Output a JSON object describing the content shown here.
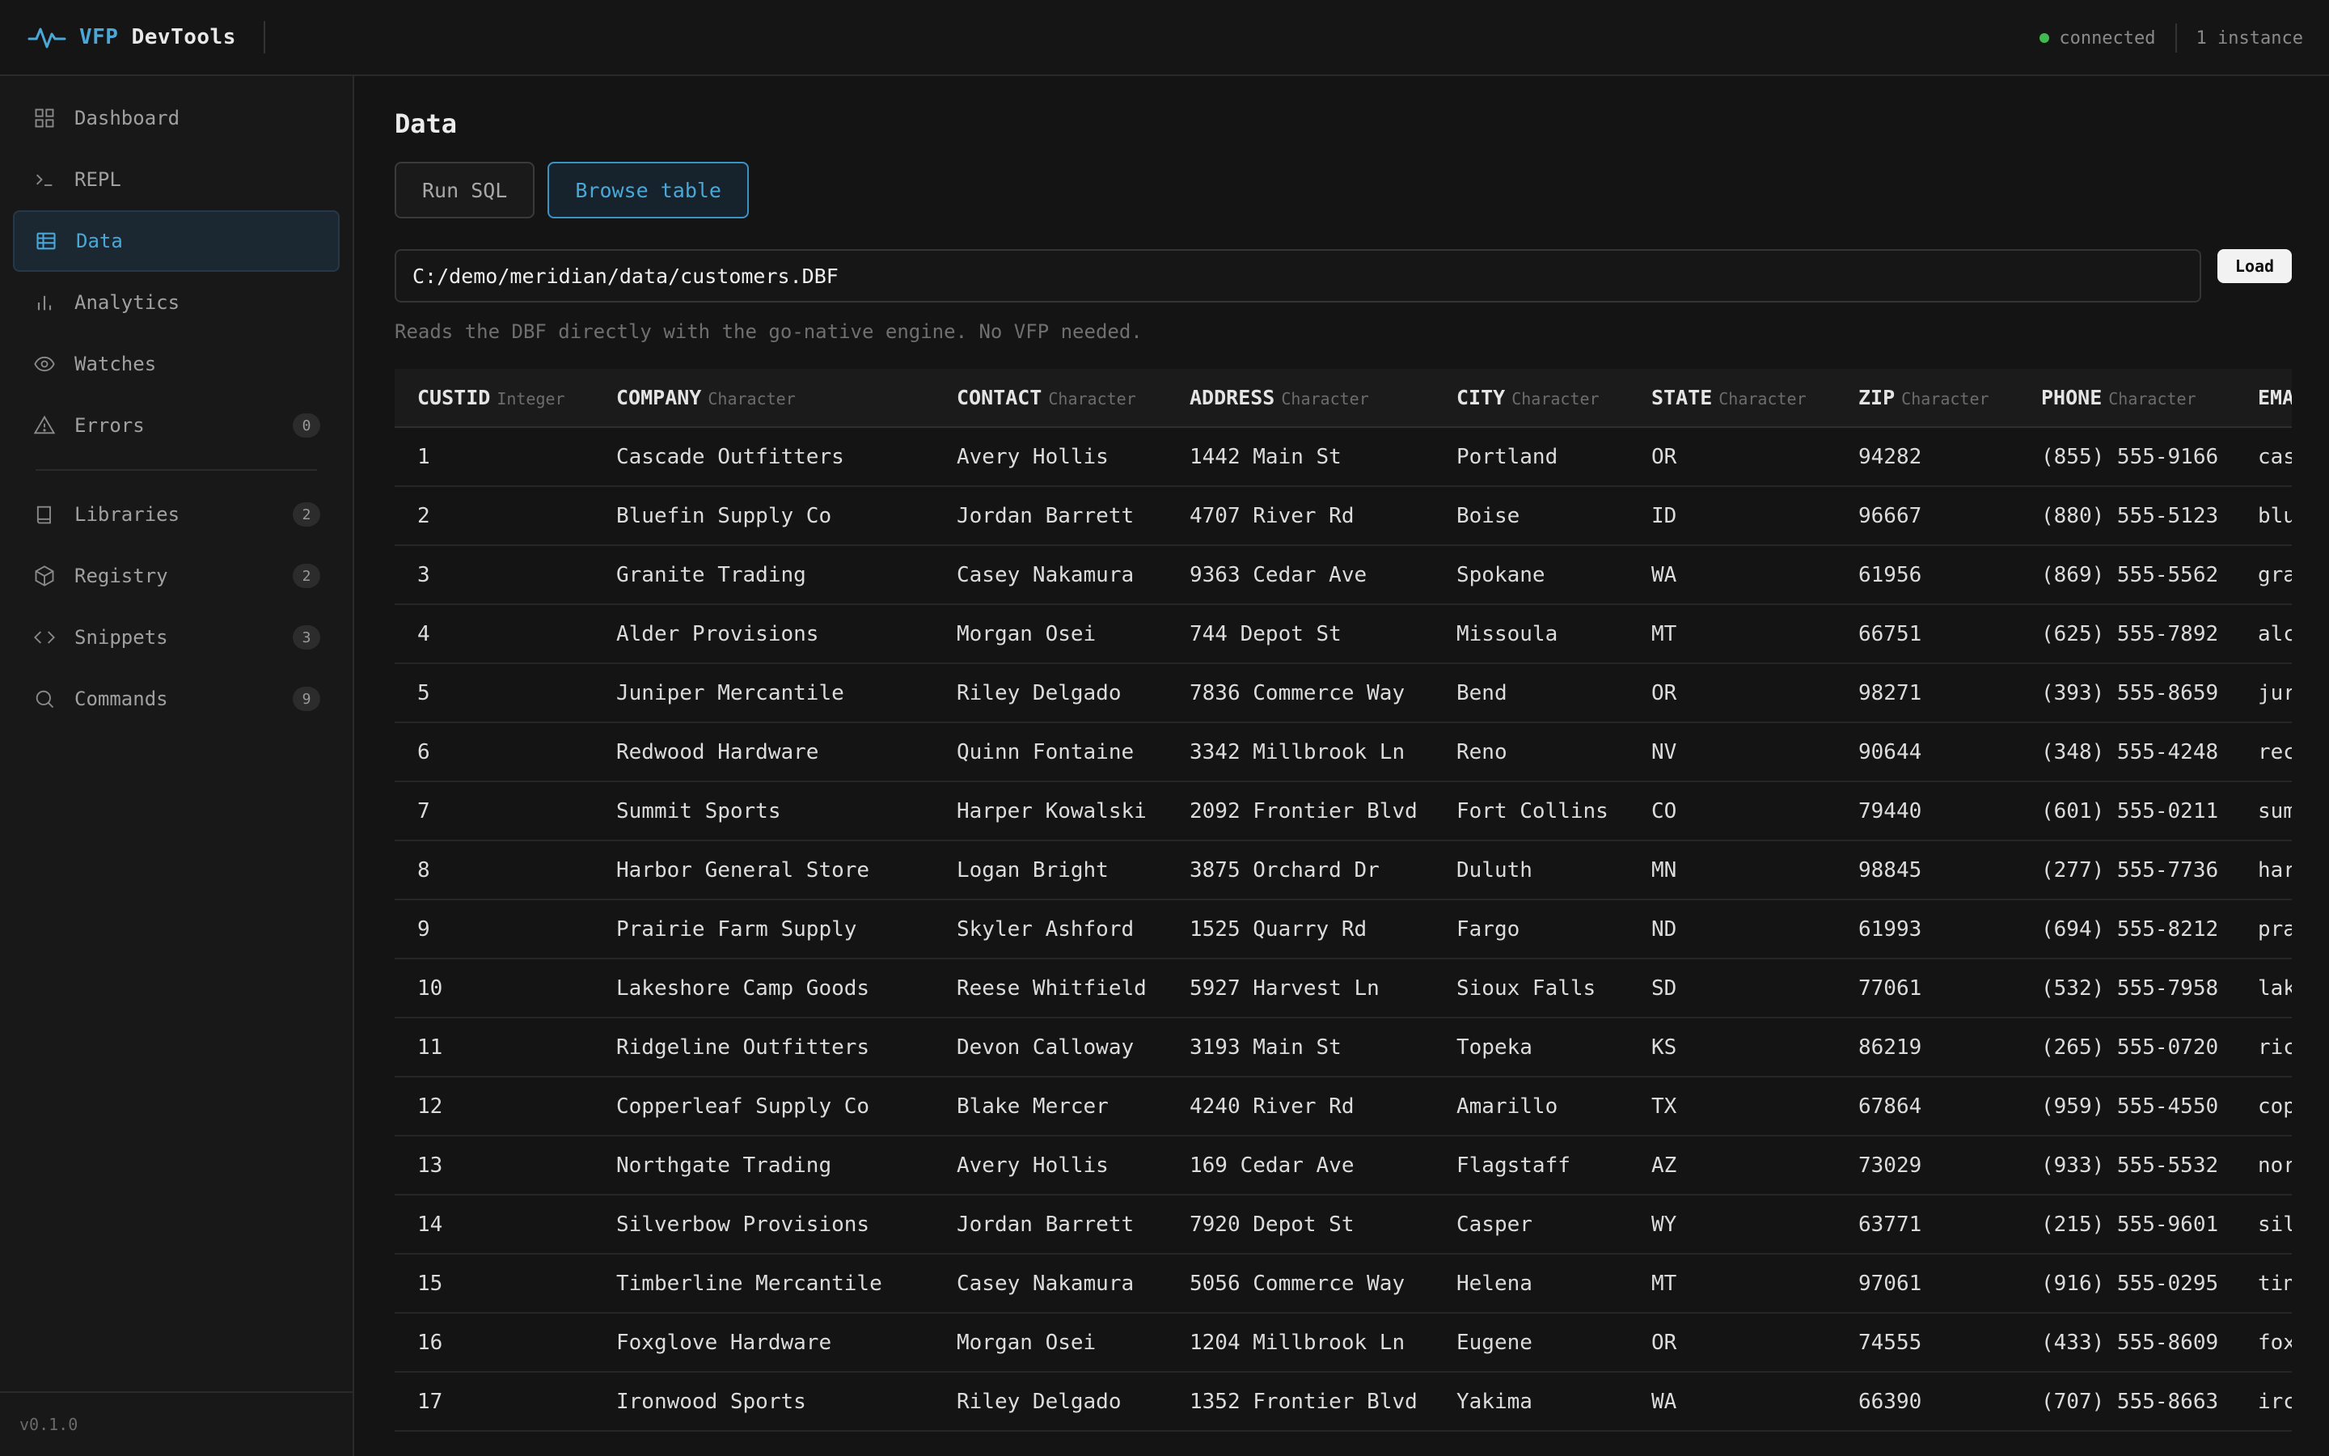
{
  "app": {
    "brand_accent": "VFP",
    "brand_rest": " DevTools",
    "status_text": "connected",
    "instance_text": "1 instance",
    "version": "v0.1.0"
  },
  "sidebar": {
    "items": [
      {
        "label": "Dashboard",
        "icon": "dashboard-icon"
      },
      {
        "label": "REPL",
        "icon": "terminal-icon"
      },
      {
        "label": "Data",
        "icon": "table-icon",
        "active": true
      },
      {
        "label": "Analytics",
        "icon": "bar-chart-icon"
      },
      {
        "label": "Watches",
        "icon": "eye-icon"
      },
      {
        "label": "Errors",
        "icon": "warning-icon",
        "badge": "0"
      }
    ],
    "items2": [
      {
        "label": "Libraries",
        "icon": "book-icon",
        "badge": "2"
      },
      {
        "label": "Registry",
        "icon": "cube-icon",
        "badge": "2"
      },
      {
        "label": "Snippets",
        "icon": "code-icon",
        "badge": "3"
      },
      {
        "label": "Commands",
        "icon": "search-icon",
        "badge": "9"
      }
    ]
  },
  "main": {
    "title": "Data",
    "tabs": [
      {
        "label": "Run SQL"
      },
      {
        "label": "Browse table",
        "active": true
      }
    ],
    "path_value": "C:/demo/meridian/data/customers.DBF",
    "load_label": "Load",
    "hint": "Reads the DBF directly with the go-native engine. No VFP needed."
  },
  "table": {
    "columns": [
      {
        "name": "CUSTID",
        "type": "Integer"
      },
      {
        "name": "COMPANY",
        "type": "Character"
      },
      {
        "name": "CONTACT",
        "type": "Character"
      },
      {
        "name": "ADDRESS",
        "type": "Character"
      },
      {
        "name": "CITY",
        "type": "Character"
      },
      {
        "name": "STATE",
        "type": "Character"
      },
      {
        "name": "ZIP",
        "type": "Character"
      },
      {
        "name": "PHONE",
        "type": "Character"
      },
      {
        "name": "EMA",
        "type": ""
      }
    ],
    "rows": [
      [
        "1",
        "Cascade Outfitters",
        "Avery Hollis",
        "1442 Main St",
        "Portland",
        "OR",
        "94282",
        "(855) 555-9166",
        "cas"
      ],
      [
        "2",
        "Bluefin Supply Co",
        "Jordan Barrett",
        "4707 River Rd",
        "Boise",
        "ID",
        "96667",
        "(880) 555-5123",
        "blu"
      ],
      [
        "3",
        "Granite Trading",
        "Casey Nakamura",
        "9363 Cedar Ave",
        "Spokane",
        "WA",
        "61956",
        "(869) 555-5562",
        "gra"
      ],
      [
        "4",
        "Alder Provisions",
        "Morgan Osei",
        "744 Depot St",
        "Missoula",
        "MT",
        "66751",
        "(625) 555-7892",
        "alc"
      ],
      [
        "5",
        "Juniper Mercantile",
        "Riley Delgado",
        "7836 Commerce Way",
        "Bend",
        "OR",
        "98271",
        "(393) 555-8659",
        "jur"
      ],
      [
        "6",
        "Redwood Hardware",
        "Quinn Fontaine",
        "3342 Millbrook Ln",
        "Reno",
        "NV",
        "90644",
        "(348) 555-4248",
        "rec"
      ],
      [
        "7",
        "Summit Sports",
        "Harper Kowalski",
        "2092 Frontier Blvd",
        "Fort Collins",
        "CO",
        "79440",
        "(601) 555-0211",
        "sum"
      ],
      [
        "8",
        "Harbor General Store",
        "Logan Bright",
        "3875 Orchard Dr",
        "Duluth",
        "MN",
        "98845",
        "(277) 555-7736",
        "har"
      ],
      [
        "9",
        "Prairie Farm Supply",
        "Skyler Ashford",
        "1525 Quarry Rd",
        "Fargo",
        "ND",
        "61993",
        "(694) 555-8212",
        "pra"
      ],
      [
        "10",
        "Lakeshore Camp Goods",
        "Reese Whitfield",
        "5927 Harvest Ln",
        "Sioux Falls",
        "SD",
        "77061",
        "(532) 555-7958",
        "lak"
      ],
      [
        "11",
        "Ridgeline Outfitters",
        "Devon Calloway",
        "3193 Main St",
        "Topeka",
        "KS",
        "86219",
        "(265) 555-0720",
        "ric"
      ],
      [
        "12",
        "Copperleaf Supply Co",
        "Blake Mercer",
        "4240 River Rd",
        "Amarillo",
        "TX",
        "67864",
        "(959) 555-4550",
        "cop"
      ],
      [
        "13",
        "Northgate Trading",
        "Avery Hollis",
        "169 Cedar Ave",
        "Flagstaff",
        "AZ",
        "73029",
        "(933) 555-5532",
        "nor"
      ],
      [
        "14",
        "Silverbow Provisions",
        "Jordan Barrett",
        "7920 Depot St",
        "Casper",
        "WY",
        "63771",
        "(215) 555-9601",
        "sil"
      ],
      [
        "15",
        "Timberline Mercantile",
        "Casey Nakamura",
        "5056 Commerce Way",
        "Helena",
        "MT",
        "97061",
        "(916) 555-0295",
        "tin"
      ],
      [
        "16",
        "Foxglove Hardware",
        "Morgan Osei",
        "1204 Millbrook Ln",
        "Eugene",
        "OR",
        "74555",
        "(433) 555-8609",
        "fox"
      ],
      [
        "17",
        "Ironwood Sports",
        "Riley Delgado",
        "1352 Frontier Blvd",
        "Yakima",
        "WA",
        "66390",
        "(707) 555-8663",
        "irc"
      ]
    ]
  }
}
